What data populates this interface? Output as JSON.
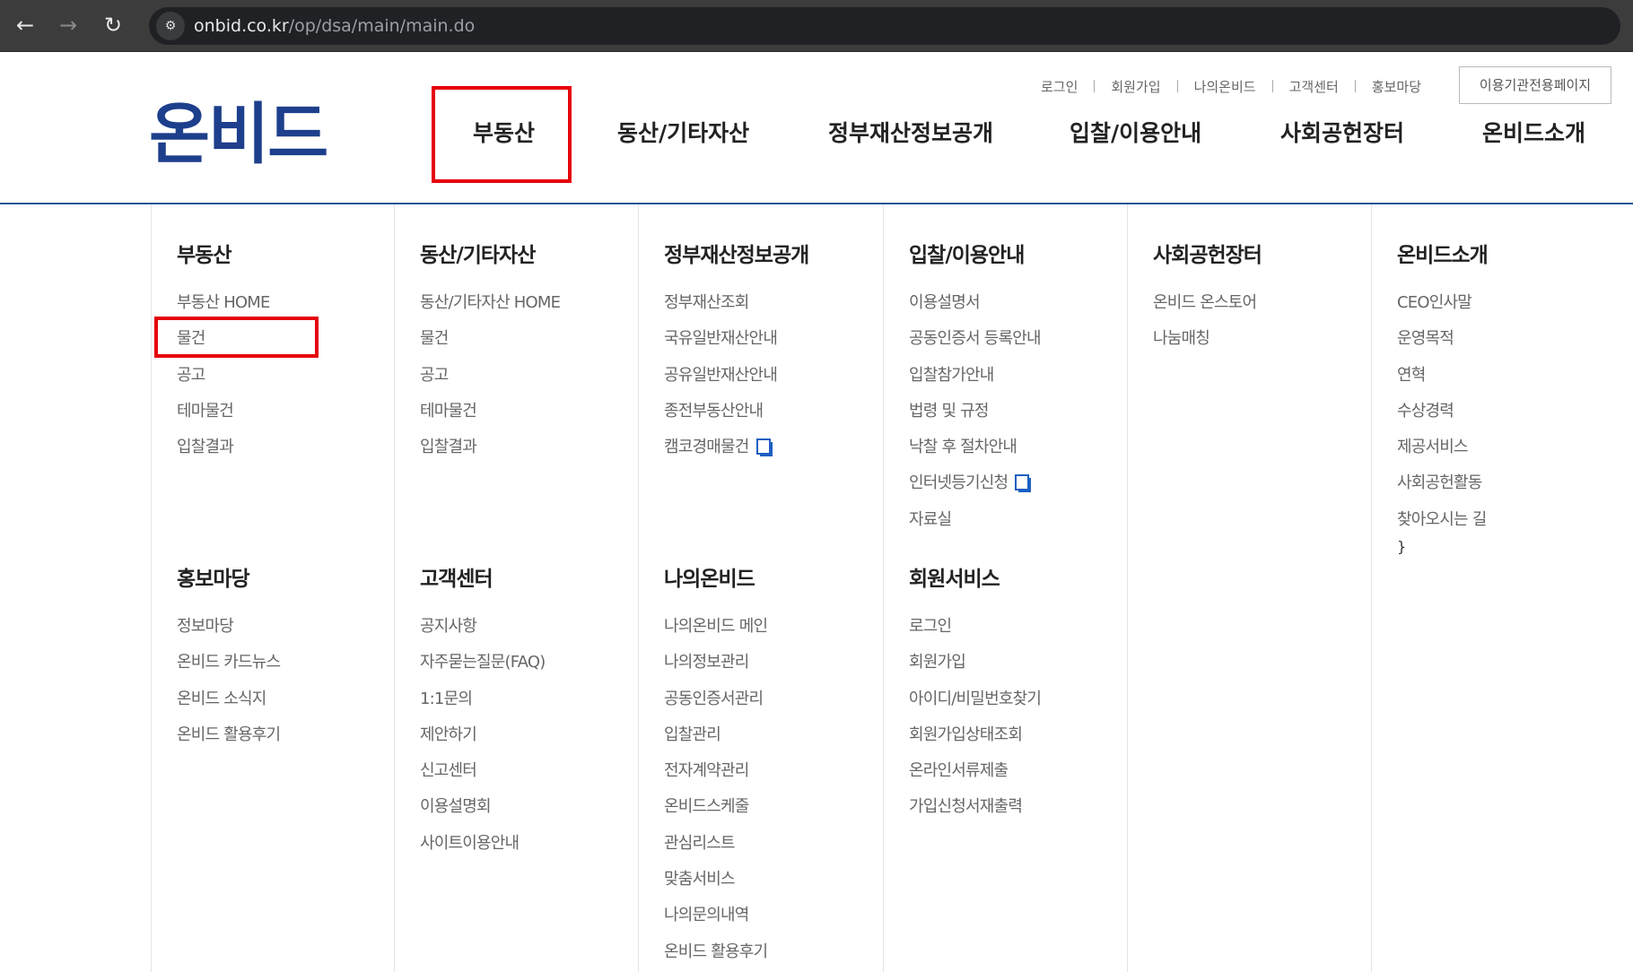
{
  "browser": {
    "url_host": "onbid.co.kr",
    "url_path": "/op/dsa/main/main.do",
    "back_icon": "←",
    "forward_icon": "→",
    "reload_icon": "↻",
    "site_info_icon": "⚙"
  },
  "header": {
    "logo_text": "온비드",
    "util_menu": [
      "로그인",
      "회원가입",
      "나의온비드",
      "고객센터",
      "홍보마당"
    ],
    "agency_button": "이용기관전용페이지",
    "gnb": [
      "부동산",
      "동산/기타자산",
      "정부재산정보공개",
      "입찰/이용안내",
      "사회공헌장터",
      "온비드소개"
    ]
  },
  "mega_menu": {
    "row1": [
      {
        "title": "부동산",
        "items": [
          "부동산 HOME",
          "물건",
          "공고",
          "테마물건",
          "입찰결과"
        ]
      },
      {
        "title": "동산/기타자산",
        "items": [
          "동산/기타자산 HOME",
          "물건",
          "공고",
          "테마물건",
          "입찰결과"
        ]
      },
      {
        "title": "정부재산정보공개",
        "items": [
          "정부재산조회",
          "국유일반재산안내",
          "공유일반재산안내",
          "종전부동산안내",
          "캠코경매물건"
        ]
      },
      {
        "title": "입찰/이용안내",
        "items": [
          "이용설명서",
          "공동인증서 등록안내",
          "입찰참가안내",
          "법령 및 규정",
          "낙찰 후 절차안내",
          "인터넷등기신청",
          "자료실"
        ]
      },
      {
        "title": "사회공헌장터",
        "items": [
          "온비드 온스토어",
          "나눔매칭"
        ]
      },
      {
        "title": "온비드소개",
        "items": [
          "CEO인사말",
          "운영목적",
          "연혁",
          "수상경력",
          "제공서비스",
          "사회공헌활동",
          "찾아오시는 길"
        ]
      }
    ],
    "row2": [
      {
        "title": "홍보마당",
        "items": [
          "정보마당",
          "온비드 카드뉴스",
          "온비드 소식지",
          "온비드 활용후기"
        ]
      },
      {
        "title": "고객센터",
        "items": [
          "공지사항",
          "자주묻는질문(FAQ)",
          "1:1문의",
          "제안하기",
          "신고센터",
          "이용설명회",
          "사이트이용안내"
        ]
      },
      {
        "title": "나의온비드",
        "items": [
          "나의온비드 메인",
          "나의정보관리",
          "공동인증서관리",
          "입찰관리",
          "전자계약관리",
          "온비드스케줄",
          "관심리스트",
          "맞춤서비스",
          "나의문의내역",
          "온비드 활용후기"
        ]
      },
      {
        "title": "회원서비스",
        "items": [
          "로그인",
          "회원가입",
          "아이디/비밀번호찾기",
          "회원가입상태조회",
          "온라인서류제출",
          "가입신청서재출력"
        ]
      }
    ]
  },
  "colors": {
    "accent": "#1d3f8c",
    "highlight": "#e5000b",
    "external_icon": "#1d5fc1"
  }
}
